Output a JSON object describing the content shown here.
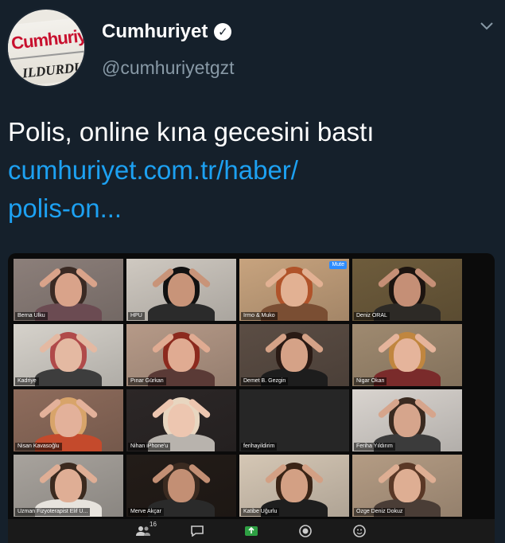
{
  "account": {
    "display_name": "Cumhuriyet",
    "handle": "@cumhuriyetgzt",
    "avatar_logo": "Cumhuriyet",
    "avatar_sub": "ILDURDUR"
  },
  "tweet": {
    "headline": "Polis, online kına gecesini bastı",
    "link_line1": "cumhuriyet.com.tr/haber/",
    "link_line2": "polis-on..."
  },
  "video_call": {
    "participants": [
      {
        "name": "Berna Ulku",
        "badge": "",
        "bg": "#8c7f7a",
        "hair": "#3a2a24",
        "skin": "#d9a38a",
        "shirt": "#6b4b52"
      },
      {
        "name": "HPU",
        "badge": "",
        "bg": "#cfc9c1",
        "hair": "#111111",
        "skin": "#c89479",
        "shirt": "#2b2b2b"
      },
      {
        "name": "Irmo & Muko",
        "badge": "Mute",
        "bg": "#c7a37e",
        "hair": "#b0532a",
        "skin": "#e2b193",
        "shirt": "#7a4e33"
      },
      {
        "name": "Deniz ORAL",
        "badge": "",
        "bg": "#6e5c3c",
        "hair": "#1c1410",
        "skin": "#c58f76",
        "shirt": "#2d2a26"
      },
      {
        "name": "Kadriye",
        "badge": "",
        "bg": "#d6d2cb",
        "hair": "#b04a4a",
        "skin": "#e4b9a2",
        "shirt": "#3d3d3d"
      },
      {
        "name": "Pınar Gürkan",
        "badge": "",
        "bg": "#b69a88",
        "hair": "#8c2a1e",
        "skin": "#e0ab92",
        "shirt": "#5a3a36"
      },
      {
        "name": "Demet B. Gezgin",
        "badge": "",
        "bg": "#5b4d44",
        "hair": "#2a1a14",
        "skin": "#d5a287",
        "shirt": "#1d1d1d"
      },
      {
        "name": "Nigar Okan",
        "badge": "",
        "bg": "#9f8a70",
        "hair": "#c0863f",
        "skin": "#e5b49b",
        "shirt": "#7a2b2b"
      },
      {
        "name": "Nisan Kavasoğlu",
        "badge": "",
        "bg": "#8e6c5c",
        "hair": "#d8a46a",
        "skin": "#e3b19a",
        "shirt": "#c44a2c"
      },
      {
        "name": "Nihan iPhone'u",
        "badge": "",
        "bg": "#2c2727",
        "hair": "#e8d6c0",
        "skin": "#edc6b0",
        "shirt": "#b8b3ad"
      },
      {
        "name": "ferihayildirim",
        "badge": "",
        "bg": "",
        "hair": "",
        "skin": "",
        "shirt": ""
      },
      {
        "name": "Feriha Yıldırım",
        "badge": "",
        "bg": "#d9d4cf",
        "hair": "#3a2a20",
        "skin": "#d6a58c",
        "shirt": "#3b3b3b"
      },
      {
        "name": "Uzman Fizyoterapist Elif U...",
        "badge": "",
        "bg": "#a8a39d",
        "hair": "#3b2a1f",
        "skin": "#dfae95",
        "shirt": "#e7e3dd"
      },
      {
        "name": "Merve Akçar",
        "badge": "",
        "bg": "#231c18",
        "hair": "#3a2a20",
        "skin": "#c38f74",
        "shirt": "#2a2a2a"
      },
      {
        "name": "Katibe Uğurlu",
        "badge": "",
        "bg": "#d5c7b5",
        "hair": "#3a2416",
        "skin": "#d3a084",
        "shirt": "#1e1e1e"
      },
      {
        "name": "Özge Deniz Dokuz",
        "badge": "",
        "bg": "#b49c84",
        "hair": "#5a3826",
        "skin": "#deae93",
        "shirt": "#4a3d36"
      }
    ],
    "participant_count": "16",
    "toolbar_icons": [
      "participants-icon",
      "chat-icon",
      "share-screen-icon",
      "record-icon",
      "reactions-icon"
    ]
  }
}
